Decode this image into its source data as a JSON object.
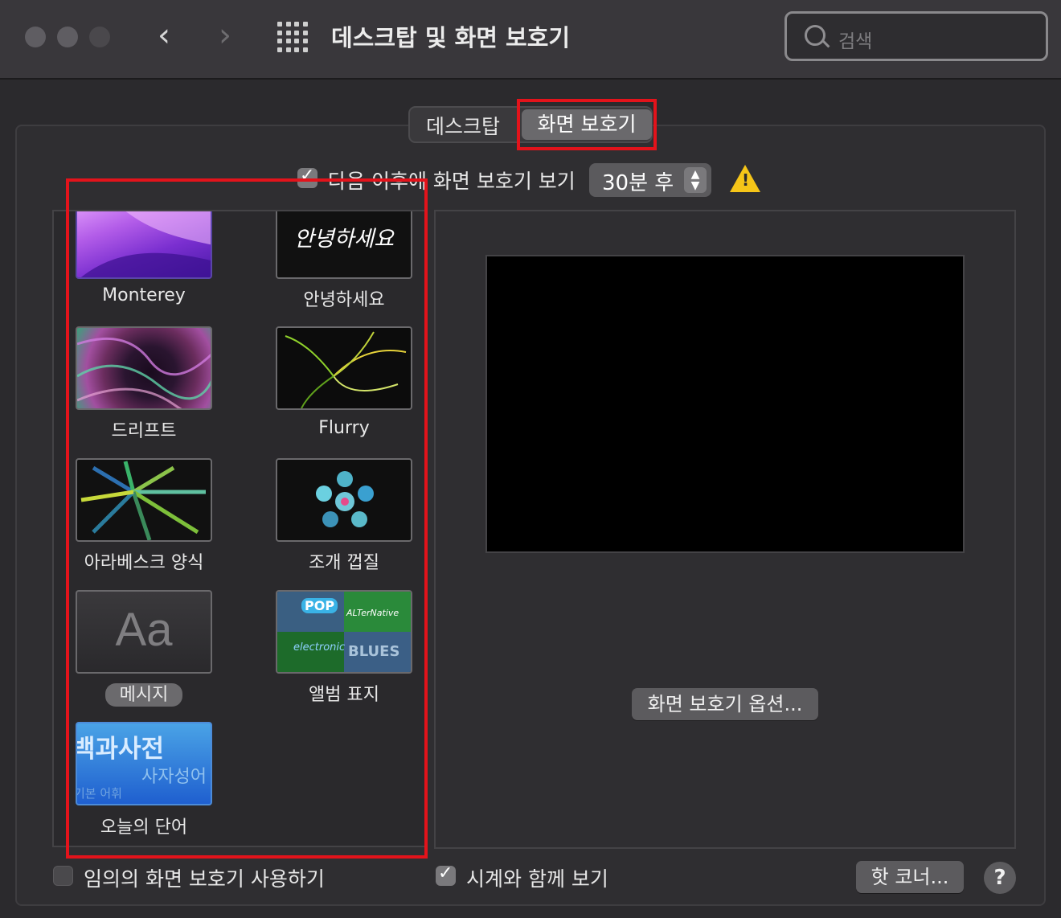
{
  "window": {
    "title": "데스크탑 및 화면 보호기",
    "search_placeholder": "검색"
  },
  "tabs": [
    {
      "label": "데스크탑",
      "selected": false
    },
    {
      "label": "화면 보호기",
      "selected": true
    }
  ],
  "start_after": {
    "checked": true,
    "label": "다음 이후에 화면 보호기 보기",
    "value": "30분 후",
    "warning_icon": "warning-triangle-icon"
  },
  "savers": [
    {
      "label": "Monterey",
      "selected": false
    },
    {
      "label": "안녕하세요",
      "selected": false,
      "thumb_text": "안녕하세요"
    },
    {
      "label": "드리프트",
      "selected": false
    },
    {
      "label": "Flurry",
      "selected": false
    },
    {
      "label": "아라베스크 양식",
      "selected": false
    },
    {
      "label": "조개 껍질",
      "selected": false
    },
    {
      "label": "메시지",
      "selected": true,
      "thumb_text": "Aa"
    },
    {
      "label": "앨범 표지",
      "selected": false,
      "thumb_texts": [
        "BLUES",
        "POP",
        "ALTerNative",
        "electronic"
      ]
    },
    {
      "label": "오늘의 단어",
      "selected": false,
      "thumb_texts": [
        "백과사전",
        "사자성어",
        "기본 어휘"
      ]
    }
  ],
  "preview": {
    "options_button": "화면 보호기 옵션..."
  },
  "footer": {
    "random_label": "임의의 화면 보호기 사용하기",
    "random_checked": false,
    "clock_label": "시계와 함께 보기",
    "clock_checked": true,
    "hot_corners_button": "핫 코너...",
    "help": "?"
  },
  "highlight_color": "#e3131b"
}
